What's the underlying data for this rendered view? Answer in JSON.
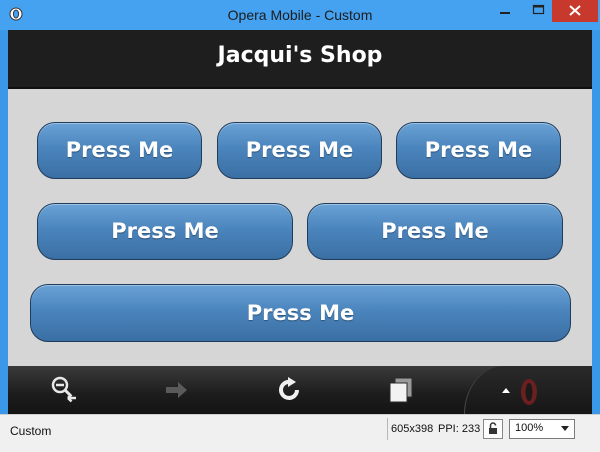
{
  "window": {
    "title": "Opera Mobile - Custom"
  },
  "header": {
    "title": "Jacqui's Shop"
  },
  "buttons": [
    {
      "label": "Press Me"
    },
    {
      "label": "Press Me"
    },
    {
      "label": "Press Me"
    },
    {
      "label": "Press Me"
    },
    {
      "label": "Press Me"
    },
    {
      "label": "Press Me"
    }
  ],
  "toolbar": {
    "items": [
      {
        "icon": "zoom-back-icon"
      },
      {
        "icon": "forward-arrow-icon"
      },
      {
        "icon": "reload-icon"
      },
      {
        "icon": "tabs-icon"
      },
      {
        "icon": "opera-menu-icon"
      }
    ]
  },
  "statusbar": {
    "profile": "Custom",
    "resolution": "605x398",
    "ppi": "PPI: 233",
    "zoom": "100%"
  },
  "colors": {
    "title_bar": "#45a2f0",
    "header_bg": "#1e1e1e",
    "button_blue": "#4b85bd",
    "close_red": "#c7392d"
  }
}
